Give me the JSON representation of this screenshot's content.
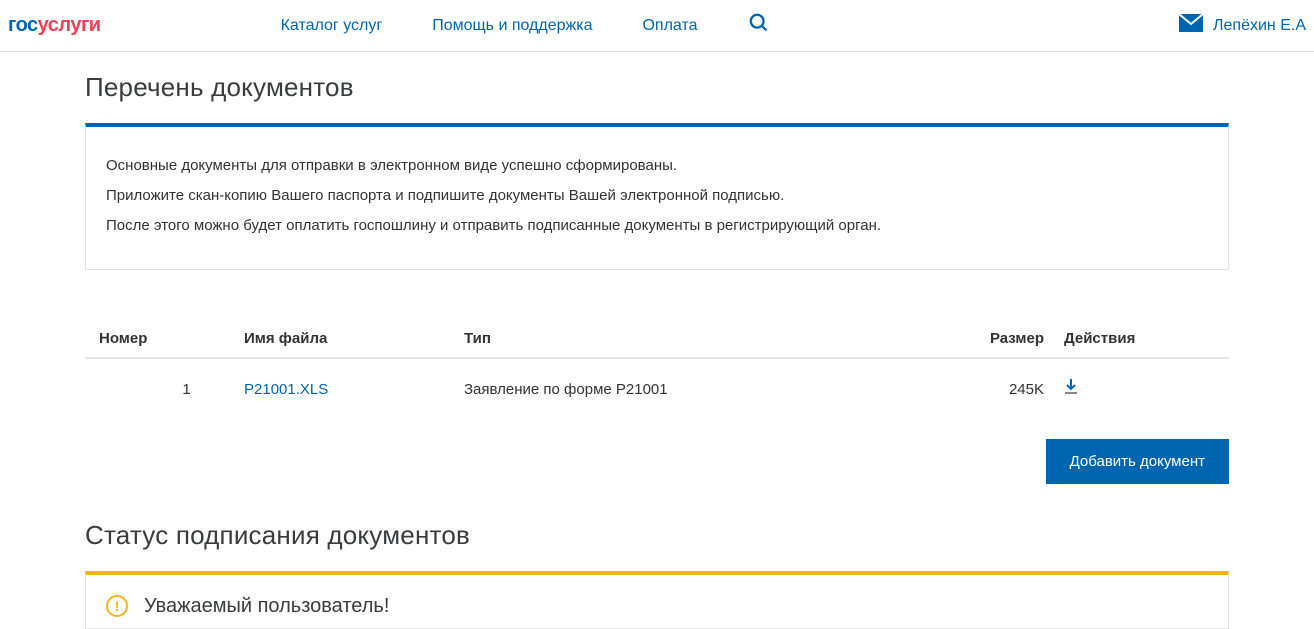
{
  "header": {
    "nav": {
      "catalog": "Каталог услуг",
      "help": "Помощь и поддержка",
      "payment": "Оплата"
    },
    "user_name": "Лепёхин Е.А"
  },
  "section1": {
    "title": "Перечень документов",
    "info_line1": "Основные документы для отправки в электронном виде успешно сформированы.",
    "info_line2": "Приложите скан-копию Вашего паспорта и подпишите документы Вашей электронной подписью.",
    "info_line3": "После этого можно будет оплатить госпошлину и отправить подписанные документы в регистрирующий орган."
  },
  "table": {
    "headers": {
      "number": "Номер",
      "filename": "Имя файла",
      "type": "Тип",
      "size": "Размер",
      "actions": "Действия"
    },
    "rows": [
      {
        "number": "1",
        "filename": "P21001.XLS",
        "type": "Заявление по форме Р21001",
        "size": "245K"
      }
    ]
  },
  "buttons": {
    "add_document": "Добавить документ"
  },
  "section2": {
    "title": "Статус подписания документов",
    "warning_title": "Уважаемый пользователь!"
  }
}
